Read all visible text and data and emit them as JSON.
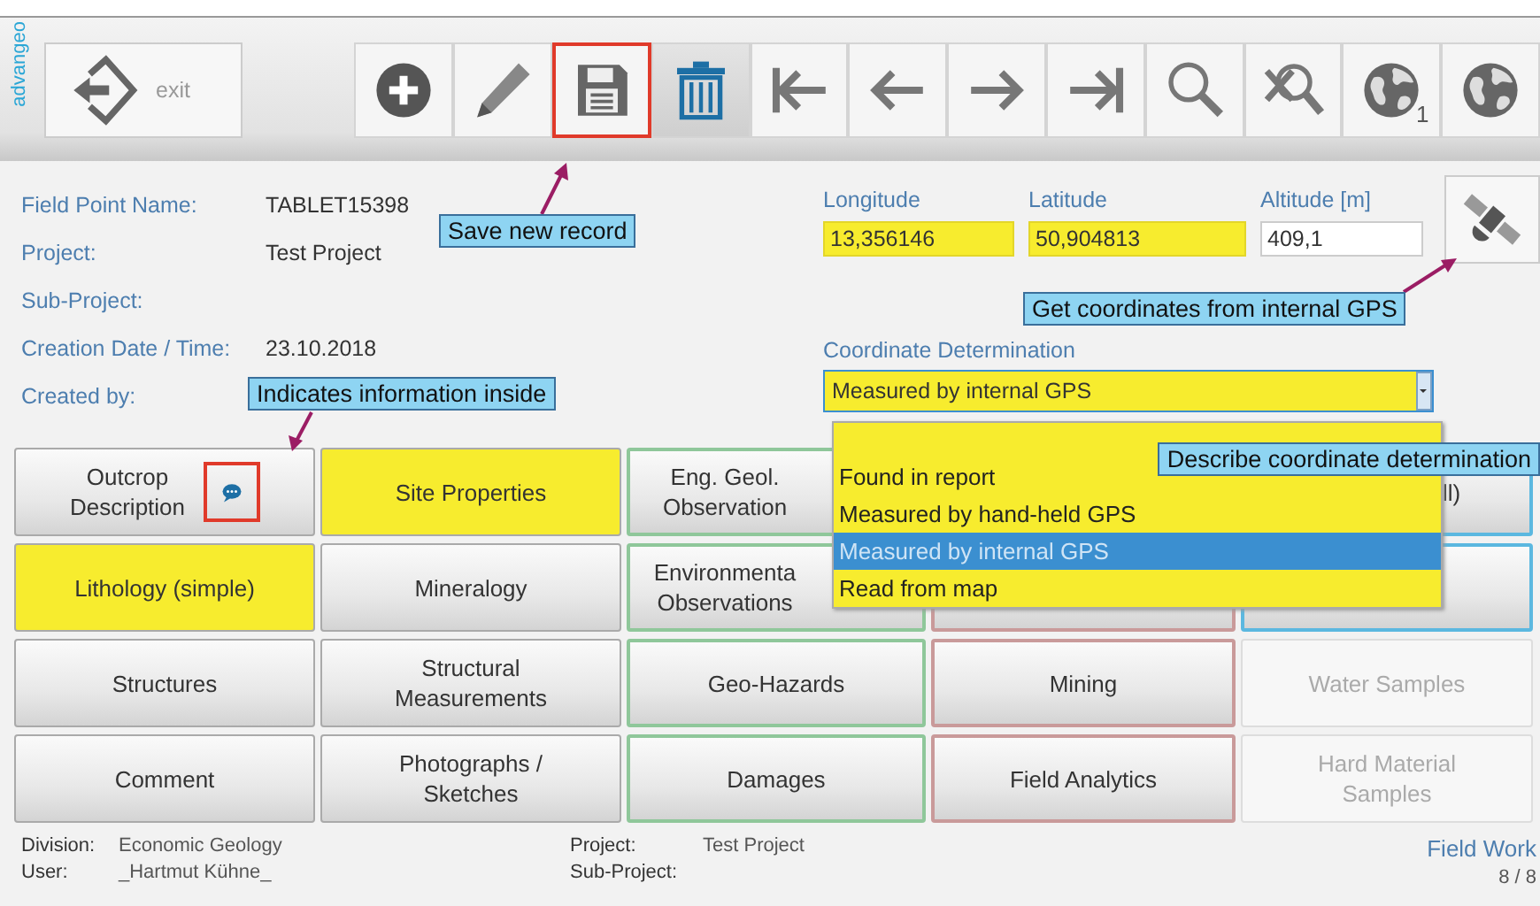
{
  "logo": "advangeo",
  "exit_button": {
    "label": "exit"
  },
  "toolbar": [
    {
      "kind": "add",
      "pressed": false,
      "highlighted": false
    },
    {
      "kind": "edit",
      "pressed": false,
      "highlighted": false
    },
    {
      "kind": "save",
      "pressed": false,
      "highlighted": true
    },
    {
      "kind": "delete",
      "pressed": true,
      "highlighted": false
    },
    {
      "kind": "first",
      "pressed": false,
      "highlighted": false
    },
    {
      "kind": "previous",
      "pressed": false,
      "highlighted": false
    },
    {
      "kind": "next",
      "pressed": false,
      "highlighted": false
    },
    {
      "kind": "last",
      "pressed": false,
      "highlighted": false
    },
    {
      "kind": "search",
      "pressed": false,
      "highlighted": false
    },
    {
      "kind": "clear-search",
      "pressed": false,
      "highlighted": false
    },
    {
      "kind": "globe",
      "badge": "1",
      "pressed": false,
      "highlighted": false
    },
    {
      "kind": "globe",
      "pressed": false,
      "highlighted": false
    }
  ],
  "info_fields": [
    {
      "label": "Field Point Name:",
      "value": "TABLET15398"
    },
    {
      "label": "Project:",
      "value": "Test Project"
    },
    {
      "label": "Sub-Project:"
    },
    {
      "label": "Creation Date / Time:",
      "value": "23.10.2018"
    },
    {
      "label": "Created by:"
    }
  ],
  "coordinates": [
    {
      "label": "Longitude",
      "value": "13,356146",
      "highlighted": true
    },
    {
      "label": "Latitude",
      "value": "50,904813",
      "highlighted": true
    },
    {
      "label": "Altitude [m]",
      "value": "409,1",
      "highlighted": false
    }
  ],
  "coordinate_determination": {
    "label": "Coordinate Determination",
    "value": "Measured by internal GPS",
    "highlighted": true,
    "expanded": true,
    "options": [
      {
        "label": "Found in report",
        "selected": false
      },
      {
        "label": "Measured by hand-held GPS",
        "selected": false
      },
      {
        "label": "Measured by internal GPS",
        "selected": true
      },
      {
        "label": "Read from map",
        "selected": false
      }
    ]
  },
  "tiles": [
    {
      "kind": "normal",
      "lines": [
        "Outcrop",
        "Description"
      ],
      "info": true,
      "info_highlighted": true
    },
    {
      "kind": "yellow",
      "lines": [
        "Site Properties"
      ]
    },
    {
      "kind": "normal",
      "lines": [
        "Eng. Geol.",
        "Observation"
      ],
      "color": "#8fc79a"
    },
    {
      "kind": "hidden"
    },
    {
      "kind": "normal",
      "lines": [
        "ll)"
      ],
      "color": "#5bb8e0"
    },
    {
      "kind": "yellow",
      "lines": [
        "Lithology (simple)"
      ]
    },
    {
      "kind": "normal",
      "lines": [
        "Mineralogy"
      ]
    },
    {
      "kind": "normal",
      "lines": [
        "Environmenta",
        "Observations"
      ],
      "color": "#8fc79a"
    },
    {
      "kind": "normal",
      "color": "#c99a9a"
    },
    {
      "kind": "normal",
      "color": "#5bb8e0"
    },
    {
      "kind": "normal",
      "lines": [
        "Structures"
      ]
    },
    {
      "kind": "normal",
      "lines": [
        "Structural",
        "Measurements"
      ]
    },
    {
      "kind": "normal",
      "lines": [
        "Geo-Hazards"
      ],
      "color": "#8fc79a"
    },
    {
      "kind": "normal",
      "lines": [
        "Mining"
      ],
      "color": "#c99a9a"
    },
    {
      "kind": "disabled",
      "lines": [
        "Water Samples"
      ]
    },
    {
      "kind": "normal",
      "lines": [
        "Comment"
      ]
    },
    {
      "kind": "normal",
      "lines": [
        "Photographs /",
        "Sketches"
      ]
    },
    {
      "kind": "normal",
      "lines": [
        "Damages"
      ],
      "color": "#8fc79a"
    },
    {
      "kind": "normal",
      "lines": [
        "Field Analytics"
      ],
      "color": "#c99a9a"
    },
    {
      "kind": "disabled",
      "lines": [
        "Hard Material",
        "Samples"
      ]
    }
  ],
  "status_bar": {
    "division_label": "Division:",
    "division": "Economic Geology",
    "user_label": "User:",
    "user": "_Hartmut Kühne_",
    "project_label": "Project:",
    "project": "Test Project",
    "sub_project_label": "Sub-Project:",
    "module": "Field Work",
    "page": "8 / 8"
  },
  "callouts": [
    {
      "text": "Save new record"
    },
    {
      "text": "Get coordinates from internal GPS"
    },
    {
      "text": "Indicates information inside"
    },
    {
      "text": "Describe coordinate determination"
    }
  ]
}
